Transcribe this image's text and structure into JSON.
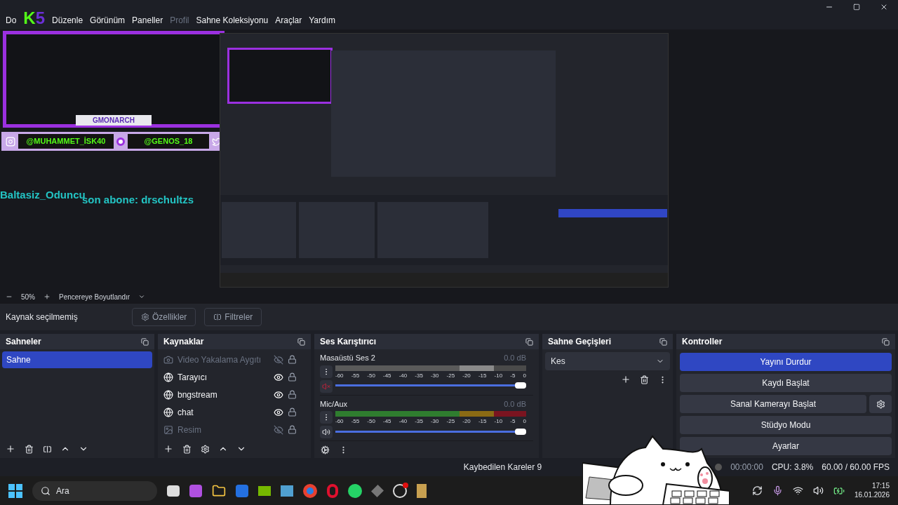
{
  "menu": [
    {
      "label": "Do",
      "disabled": false
    },
    {
      "label": "Düzenle",
      "disabled": false
    },
    {
      "label": "Görünüm",
      "disabled": false
    },
    {
      "label": "Paneller",
      "disabled": false
    },
    {
      "label": "Profil",
      "disabled": true
    },
    {
      "label": "Sahne Koleksiyonu",
      "disabled": false
    },
    {
      "label": "Araçlar",
      "disabled": false
    },
    {
      "label": "Yardım",
      "disabled": false
    }
  ],
  "logo": {
    "letter": "K",
    "digit": "5"
  },
  "overlay": {
    "frame_label": "GMONARCH",
    "handles": [
      "@MUHAMMET_İSK40",
      "@GENOS_18"
    ]
  },
  "preview_texts": {
    "name_ticker": "Baltasiz_Oduncu",
    "last_subscriber": "son abone: drschultzs"
  },
  "preview_toolbar": {
    "zoom": "50%",
    "fit": "Pencereye Boyutlandır"
  },
  "source_bar": {
    "status": "Kaynak seçilmemiş",
    "buttons": [
      {
        "label": "Özellikler",
        "kind": "properties"
      },
      {
        "label": "Filtreler",
        "kind": "filters"
      }
    ]
  },
  "scenes": {
    "title": "Sahneler",
    "items": [
      {
        "label": "Sahne",
        "selected": true
      }
    ]
  },
  "sources": {
    "title": "Kaynaklar",
    "items": [
      {
        "label": "Video Yakalama Aygıtı",
        "kind": "camera",
        "visible": false
      },
      {
        "label": "Tarayıcı",
        "kind": "browser",
        "visible": true
      },
      {
        "label": "bngstream",
        "kind": "browser",
        "visible": true
      },
      {
        "label": "chat",
        "kind": "browser",
        "visible": true
      },
      {
        "label": "Resim",
        "kind": "image",
        "visible": false
      }
    ]
  },
  "mixer": {
    "title": "Ses Karıştırıcı",
    "channels": [
      {
        "name": "Masaüstü Ses 2",
        "reading": "0.0 dB",
        "muted": true,
        "level": 1,
        "scale": [
          "-60",
          "-55",
          "-50",
          "-45",
          "-40",
          "-35",
          "-30",
          "-25",
          "-20",
          "-15",
          "-10",
          "-5",
          "0"
        ]
      },
      {
        "name": "Mic/Aux",
        "reading": "0.0 dB",
        "muted": false,
        "level": 1,
        "scale": [
          "-60",
          "-55",
          "-50",
          "-45",
          "-40",
          "-35",
          "-30",
          "-25",
          "-20",
          "-15",
          "-10",
          "-5",
          "0"
        ]
      }
    ]
  },
  "transitions": {
    "title": "Sahne Geçişleri",
    "selected": "Kes"
  },
  "controls": {
    "title": "Kontroller",
    "buttons": [
      {
        "label": "Yayını Durdur",
        "active": true,
        "kind": "plain"
      },
      {
        "label": "Kaydı Başlat",
        "active": false,
        "kind": "plain"
      },
      {
        "label": "Sanal Kamerayı Başlat",
        "active": false,
        "kind": "with-settings"
      },
      {
        "label": "Stüdyo Modu",
        "active": false,
        "kind": "plain"
      },
      {
        "label": "Ayarlar",
        "active": false,
        "kind": "plain"
      }
    ]
  },
  "status": {
    "dropped": "Kaybedilen Kareler 9",
    "time": "00:00:00",
    "cpu": "CPU: 3.8%",
    "fps": "60.00 / 60.00 FPS"
  },
  "taskbar": {
    "search": "Ara",
    "time": "17:15",
    "date": "16.01.2026"
  }
}
